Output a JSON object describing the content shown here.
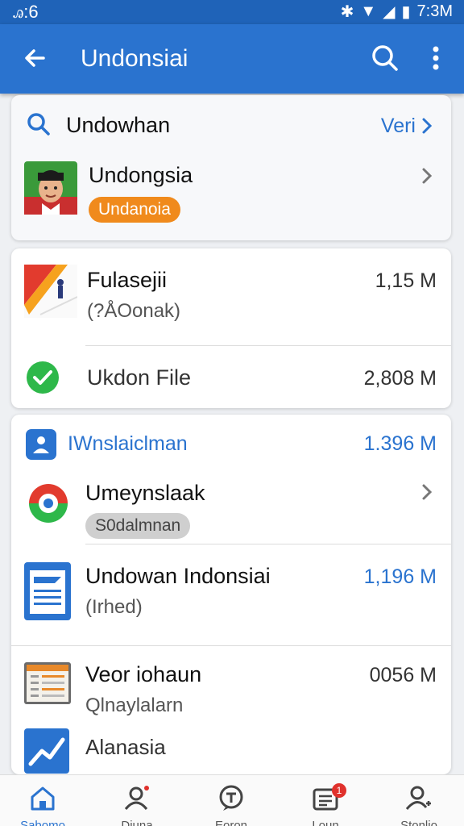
{
  "status_bar": {
    "left_time": "ꭿ:6",
    "right_time": "7:3M"
  },
  "app_bar": {
    "title": "Undonsiai"
  },
  "search_card": {
    "search_label": "Undowhan",
    "view_link": "Veri",
    "featured": {
      "title": "Undongsia",
      "badge": "Undanoia"
    }
  },
  "files_card": {
    "items": [
      {
        "title": "Fulasejii",
        "subtitle": "(?ÅOonak)",
        "size": "1,15 M"
      },
      {
        "title": "Ukdon File",
        "size": "2,808 M"
      }
    ]
  },
  "list_card": {
    "header": {
      "label": "IWnslaiclman",
      "size": "1.396 M"
    },
    "items": [
      {
        "title": "Umeynslaak",
        "badge": "S0dalmnan"
      },
      {
        "title": "Undowan Indonsiai",
        "subtitle": "(Irhed)",
        "size": "1,196 M"
      },
      {
        "title": "Veor iohaun",
        "subtitle": "Qlnaylalarn",
        "size": "0056 M"
      },
      {
        "title": "Alanasia"
      }
    ]
  },
  "bottom_nav": {
    "items": [
      {
        "label": "Sabomo"
      },
      {
        "label": "Diuna"
      },
      {
        "label": "Eoron"
      },
      {
        "label": "Loun"
      },
      {
        "label": "Stonlio"
      }
    ],
    "notification_count": "1"
  },
  "colors": {
    "primary": "#2a73cf",
    "badge_orange": "#f08a1c",
    "check_green": "#2eb84a"
  }
}
